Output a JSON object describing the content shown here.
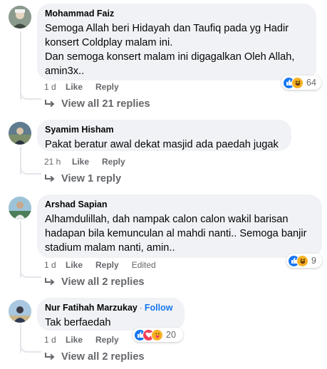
{
  "comments": [
    {
      "author": "Mohammad Faiz",
      "follow": "",
      "text": "Semoga Allah beri Hidayah dan Taufiq pada yg Hadir\nkonsert Coldplay malam ini.\nDan semoga konsert malam ini digagalkan Oleh Allah,\namin3x..",
      "time": "1 d",
      "like": "Like",
      "reply": "Reply",
      "edited": "",
      "reactions": [
        "like",
        "haha"
      ],
      "reaction_count": "64",
      "view_replies": "View all 21 replies"
    },
    {
      "author": "Syamim Hisham",
      "follow": "",
      "text": "Pakat beratur awal dekat masjid ada paedah jugak",
      "time": "21 h",
      "like": "Like",
      "reply": "Reply",
      "edited": "",
      "reactions": [],
      "reaction_count": "",
      "view_replies": "View 1 reply"
    },
    {
      "author": "Arshad Sapian",
      "follow": "",
      "text": "Alhamdulillah, dah nampak calon calon wakil barisan\nhadapan bila kemunculan al mahdi nanti.. Semoga banjir\nstadium malam nanti, amin..",
      "time": "1 d",
      "like": "Like",
      "reply": "Reply",
      "edited": "Edited",
      "reactions": [
        "like",
        "haha"
      ],
      "reaction_count": "9",
      "view_replies": "View all 2 replies"
    },
    {
      "author": "Nur Fatihah Marzukay",
      "follow": "Follow",
      "separator": "·",
      "text": "Tak berfaedah",
      "time": "1 d",
      "like": "Like",
      "reply": "Reply",
      "edited": "",
      "reactions": [
        "like",
        "love",
        "care"
      ],
      "reaction_count": "20",
      "view_replies": "View all 2 replies"
    }
  ],
  "colors": {
    "bubble": "#f0f2f5",
    "secondary_text": "#65676b",
    "follow": "#1877f2",
    "like": "#1877f2",
    "love": "#f33e58",
    "haha": "#f7b125"
  }
}
